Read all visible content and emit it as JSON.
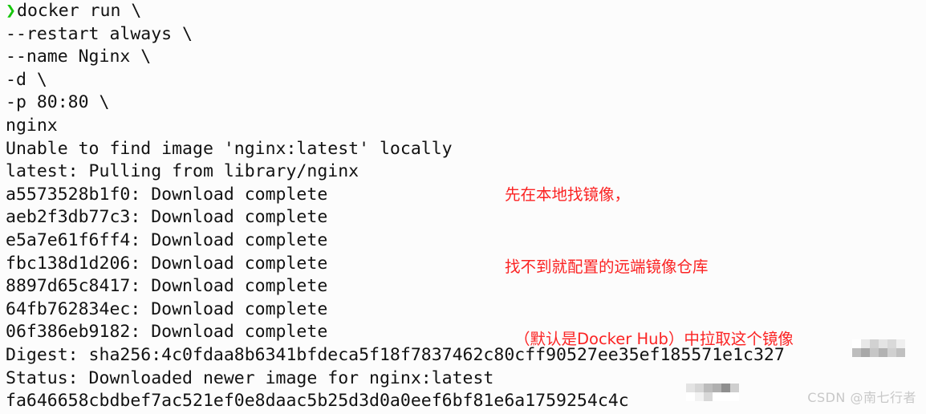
{
  "terminal": {
    "background_color": "#fcfcfc",
    "foreground_color": "#121212",
    "prompt_color": "#16c60c",
    "prompt_symbol": "❯",
    "command_lines": [
      "docker run \\",
      "--restart always \\",
      "--name Nginx \\",
      "-d \\",
      "-p 80:80 \\",
      "nginx"
    ],
    "output_lines": [
      "Unable to find image 'nginx:latest' locally",
      "latest: Pulling from library/nginx",
      "a5573528b1f0: Download complete",
      "aeb2f3db77c3: Download complete",
      "e5a7e61f6ff4: Download complete",
      "fbc138d1d206: Download complete",
      "8897d65c8417: Download complete",
      "64fb762834ec: Download complete",
      "06f386eb9182: Download complete",
      "Digest: sha256:4c0fdaa8b6341bfdeca5f18f7837462c80cff90527ee35ef185571e1c327",
      "Status: Downloaded newer image for nginx:latest",
      "fa646658cbdbef7ac521ef0e8daac5b25d3d0a0eef6bf81e6a1759254c4c"
    ]
  },
  "annotation": {
    "color": "#fb2323",
    "lines": [
      "先在本地找镜像，",
      "找不到就配置的远端镜像仓库",
      "（默认是Docker Hub）中拉取这个镜像"
    ]
  },
  "redactions": {
    "digest_tail": {
      "label": "mosaic-blur",
      "color": "#b5b5b5"
    },
    "container_id_tail": {
      "label": "mosaic-blur",
      "color": "#b5b5b5"
    }
  },
  "watermark": {
    "text": "CSDN @南七行者",
    "color": "#c8c8c8"
  }
}
